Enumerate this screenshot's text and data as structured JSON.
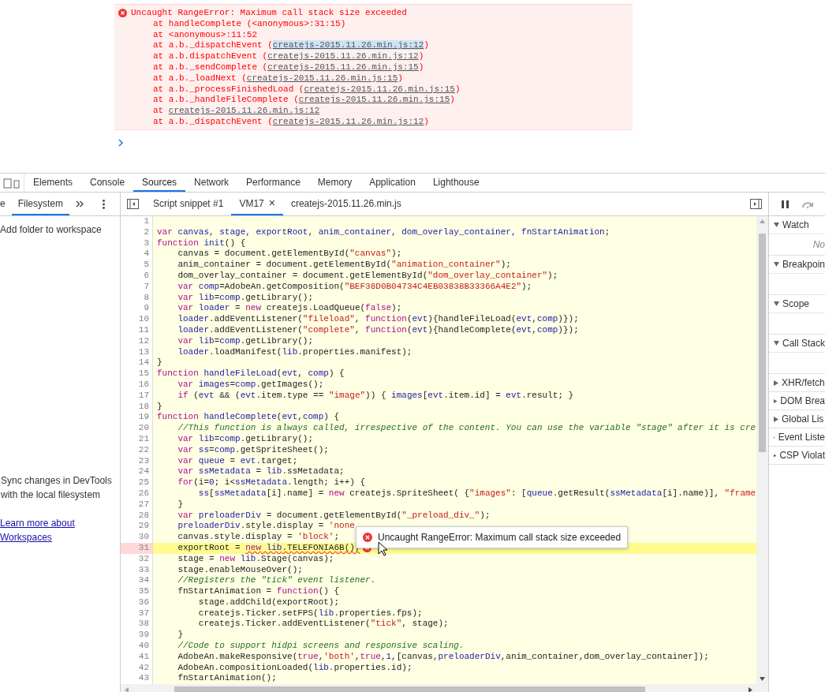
{
  "console": {
    "error": {
      "message": "Uncaught RangeError: Maximum call stack size exceeded",
      "frames": [
        {
          "text": "at handleComplete (<anonymous>:31:15)",
          "selected": false
        },
        {
          "text": "at <anonymous>:11:52",
          "selected": false
        },
        {
          "text": "at a.b._dispatchEvent (",
          "link": "createjs-2015.11.26.min.js:12",
          "after": ")",
          "selected": true
        },
        {
          "text": "at a.b.dispatchEvent (",
          "link": "createjs-2015.11.26.min.js:12",
          "after": ")",
          "selected": false
        },
        {
          "text": "at a.b._sendComplete (",
          "link": "createjs-2015.11.26.min.js:15",
          "after": ")",
          "selected": false
        },
        {
          "text": "at a.b._loadNext (",
          "link": "createjs-2015.11.26.min.js:15",
          "after": ")",
          "selected": false
        },
        {
          "text": "at a.b._processFinishedLoad (",
          "link": "createjs-2015.11.26.min.js:15",
          "after": ")",
          "selected": false
        },
        {
          "text": "at a.b._handleFileComplete (",
          "link": "createjs-2015.11.26.min.js:15",
          "after": ")",
          "selected": false
        },
        {
          "text": "at ",
          "link": "createjs-2015.11.26.min.js:12",
          "selected": false
        },
        {
          "text": "at a.b._dispatchEvent (",
          "link": "createjs-2015.11.26.min.js:12",
          "after": ")",
          "selected": false
        }
      ]
    }
  },
  "devtools": {
    "main_tabs": [
      {
        "label": "Elements",
        "selected": false
      },
      {
        "label": "Console",
        "selected": false
      },
      {
        "label": "Sources",
        "selected": true
      },
      {
        "label": "Network",
        "selected": false
      },
      {
        "label": "Performance",
        "selected": false
      },
      {
        "label": "Memory",
        "selected": false
      },
      {
        "label": "Application",
        "selected": false
      },
      {
        "label": "Lighthouse",
        "selected": false
      }
    ],
    "navigator": {
      "tabs": [
        {
          "label": "e",
          "selected": false
        },
        {
          "label": "Filesystem",
          "selected": true
        }
      ],
      "action": "Add folder to workspace",
      "info": "Sync changes in DevTools with the local filesystem",
      "link": "Learn more about Workspaces"
    },
    "editor": {
      "tabs": [
        {
          "label": "Script snippet #1",
          "selected": false
        },
        {
          "label": "VM17",
          "selected": true,
          "close": "×"
        },
        {
          "label": "createjs-2015.11.26.min.js",
          "selected": false
        }
      ],
      "lines": [
        {
          "number": "1",
          "error": false
        },
        {
          "number": "2",
          "error": false,
          "segments": [
            {
              "kind": "kw",
              "text": "var"
            },
            {
              "kind": "def",
              "text": " canvas, stage, exportRoot, anim_container, dom_overlay_container, fnStartAnimation"
            },
            {
              "kind": "txt",
              "text": ";"
            }
          ]
        },
        {
          "number": "3",
          "error": false,
          "segments": [
            {
              "kind": "kw",
              "text": "function"
            },
            {
              "kind": "def",
              "text": " init"
            },
            {
              "kind": "txt",
              "text": "() {"
            }
          ]
        },
        {
          "number": "4",
          "error": false,
          "segments": [
            {
              "kind": "txt",
              "text": "    canvas = document.getElementById("
            },
            {
              "kind": "str",
              "text": "\"canvas\""
            },
            {
              "kind": "txt",
              "text": ");"
            }
          ]
        },
        {
          "number": "5",
          "error": false,
          "segments": [
            {
              "kind": "txt",
              "text": "    anim_container = document.getElementById("
            },
            {
              "kind": "str",
              "text": "\"animation_container\""
            },
            {
              "kind": "txt",
              "text": ");"
            }
          ]
        },
        {
          "number": "6",
          "error": false,
          "segments": [
            {
              "kind": "txt",
              "text": "    dom_overlay_container = document.getElementById("
            },
            {
              "kind": "str",
              "text": "\"dom_overlay_container\""
            },
            {
              "kind": "txt",
              "text": ");"
            }
          ]
        },
        {
          "number": "7",
          "error": false,
          "segments": [
            {
              "kind": "kw",
              "text": "    var"
            },
            {
              "kind": "def",
              "text": " comp"
            },
            {
              "kind": "txt",
              "text": "=AdobeAn.getComposition("
            },
            {
              "kind": "str",
              "text": "\"BEF38D0B04734C4EB03838B33366A4E2\""
            },
            {
              "kind": "txt",
              "text": ");"
            }
          ]
        },
        {
          "number": "8",
          "error": false,
          "segments": [
            {
              "kind": "kw",
              "text": "    var"
            },
            {
              "kind": "def",
              "text": " lib"
            },
            {
              "kind": "txt",
              "text": "="
            },
            {
              "kind": "def",
              "text": "comp"
            },
            {
              "kind": "txt",
              "text": ".getLibrary();"
            }
          ]
        },
        {
          "number": "9",
          "error": false,
          "segments": [
            {
              "kind": "kw",
              "text": "    var"
            },
            {
              "kind": "def",
              "text": " loader"
            },
            {
              "kind": "txt",
              "text": " = "
            },
            {
              "kind": "kw",
              "text": "new"
            },
            {
              "kind": "txt",
              "text": " createjs.LoadQueue("
            },
            {
              "kind": "kw",
              "text": "false"
            },
            {
              "kind": "txt",
              "text": ");"
            }
          ]
        },
        {
          "number": "10",
          "error": false,
          "segments": [
            {
              "kind": "def",
              "text": "    loader"
            },
            {
              "kind": "txt",
              "text": ".addEventListener("
            },
            {
              "kind": "str",
              "text": "\"fileload\""
            },
            {
              "kind": "txt",
              "text": ", "
            },
            {
              "kind": "kw",
              "text": "function"
            },
            {
              "kind": "txt",
              "text": "("
            },
            {
              "kind": "def",
              "text": "evt"
            },
            {
              "kind": "txt",
              "text": "){handleFileLoad("
            },
            {
              "kind": "def",
              "text": "evt"
            },
            {
              "kind": "txt",
              "text": ","
            },
            {
              "kind": "def",
              "text": "comp"
            },
            {
              "kind": "txt",
              "text": ")});"
            }
          ]
        },
        {
          "number": "11",
          "error": false,
          "segments": [
            {
              "kind": "def",
              "text": "    loader"
            },
            {
              "kind": "txt",
              "text": ".addEventListener("
            },
            {
              "kind": "str",
              "text": "\"complete\""
            },
            {
              "kind": "txt",
              "text": ", "
            },
            {
              "kind": "kw",
              "text": "function"
            },
            {
              "kind": "txt",
              "text": "("
            },
            {
              "kind": "def",
              "text": "evt"
            },
            {
              "kind": "txt",
              "text": "){handleComplete("
            },
            {
              "kind": "def",
              "text": "evt"
            },
            {
              "kind": "txt",
              "text": ","
            },
            {
              "kind": "def",
              "text": "comp"
            },
            {
              "kind": "txt",
              "text": ")});"
            }
          ]
        },
        {
          "number": "12",
          "error": false,
          "segments": [
            {
              "kind": "kw",
              "text": "    var"
            },
            {
              "kind": "def",
              "text": " lib"
            },
            {
              "kind": "txt",
              "text": "="
            },
            {
              "kind": "def",
              "text": "comp"
            },
            {
              "kind": "txt",
              "text": ".getLibrary();"
            }
          ]
        },
        {
          "number": "13",
          "error": false,
          "segments": [
            {
              "kind": "def",
              "text": "    loader"
            },
            {
              "kind": "txt",
              "text": ".loadManifest("
            },
            {
              "kind": "def",
              "text": "lib"
            },
            {
              "kind": "txt",
              "text": ".properties.manifest);"
            }
          ]
        },
        {
          "number": "14",
          "error": false,
          "segments": [
            {
              "kind": "txt",
              "text": "}"
            }
          ]
        },
        {
          "number": "15",
          "error": false,
          "segments": [
            {
              "kind": "kw",
              "text": "function"
            },
            {
              "kind": "def",
              "text": " handleFileLoad"
            },
            {
              "kind": "txt",
              "text": "("
            },
            {
              "kind": "def",
              "text": "evt"
            },
            {
              "kind": "txt",
              "text": ", "
            },
            {
              "kind": "def",
              "text": "comp"
            },
            {
              "kind": "txt",
              "text": ") {"
            }
          ]
        },
        {
          "number": "16",
          "error": false,
          "segments": [
            {
              "kind": "kw",
              "text": "    var"
            },
            {
              "kind": "def",
              "text": " images"
            },
            {
              "kind": "txt",
              "text": "="
            },
            {
              "kind": "def",
              "text": "comp"
            },
            {
              "kind": "txt",
              "text": ".getImages();"
            }
          ]
        },
        {
          "number": "17",
          "error": false,
          "segments": [
            {
              "kind": "kw",
              "text": "    if"
            },
            {
              "kind": "txt",
              "text": " ("
            },
            {
              "kind": "def",
              "text": "evt"
            },
            {
              "kind": "txt",
              "text": " && ("
            },
            {
              "kind": "def",
              "text": "evt"
            },
            {
              "kind": "txt",
              "text": ".item.type == "
            },
            {
              "kind": "str",
              "text": "\"image\""
            },
            {
              "kind": "txt",
              "text": ")) { "
            },
            {
              "kind": "def",
              "text": "images"
            },
            {
              "kind": "txt",
              "text": "["
            },
            {
              "kind": "def",
              "text": "evt"
            },
            {
              "kind": "txt",
              "text": ".item.id] = "
            },
            {
              "kind": "def",
              "text": "evt"
            },
            {
              "kind": "txt",
              "text": ".result; }"
            }
          ]
        },
        {
          "number": "18",
          "error": false,
          "segments": [
            {
              "kind": "txt",
              "text": "}"
            }
          ]
        },
        {
          "number": "19",
          "error": false,
          "segments": [
            {
              "kind": "kw",
              "text": "function"
            },
            {
              "kind": "def",
              "text": " handleComplete"
            },
            {
              "kind": "txt",
              "text": "("
            },
            {
              "kind": "def",
              "text": "evt"
            },
            {
              "kind": "txt",
              "text": ","
            },
            {
              "kind": "def",
              "text": "comp"
            },
            {
              "kind": "txt",
              "text": ") {"
            }
          ]
        },
        {
          "number": "20",
          "error": false,
          "segments": [
            {
              "kind": "com",
              "text": "    //This function is always called, irrespective of the content. You can use the variable \"stage\" after it is cre"
            }
          ]
        },
        {
          "number": "21",
          "error": false,
          "segments": [
            {
              "kind": "kw",
              "text": "    var"
            },
            {
              "kind": "def",
              "text": " lib"
            },
            {
              "kind": "txt",
              "text": "="
            },
            {
              "kind": "def",
              "text": "comp"
            },
            {
              "kind": "txt",
              "text": ".getLibrary();"
            }
          ]
        },
        {
          "number": "22",
          "error": false,
          "segments": [
            {
              "kind": "kw",
              "text": "    var"
            },
            {
              "kind": "def",
              "text": " ss"
            },
            {
              "kind": "txt",
              "text": "="
            },
            {
              "kind": "def",
              "text": "comp"
            },
            {
              "kind": "txt",
              "text": ".getSpriteSheet();"
            }
          ]
        },
        {
          "number": "23",
          "error": false,
          "segments": [
            {
              "kind": "kw",
              "text": "    var"
            },
            {
              "kind": "def",
              "text": " queue"
            },
            {
              "kind": "txt",
              "text": " = "
            },
            {
              "kind": "def",
              "text": "evt"
            },
            {
              "kind": "txt",
              "text": ".target;"
            }
          ]
        },
        {
          "number": "24",
          "error": false,
          "segments": [
            {
              "kind": "kw",
              "text": "    var"
            },
            {
              "kind": "def",
              "text": " ssMetadata"
            },
            {
              "kind": "txt",
              "text": " = "
            },
            {
              "kind": "def",
              "text": "lib"
            },
            {
              "kind": "txt",
              "text": ".ssMetadata;"
            }
          ]
        },
        {
          "number": "25",
          "error": false,
          "segments": [
            {
              "kind": "kw",
              "text": "    for"
            },
            {
              "kind": "txt",
              "text": "(i="
            },
            {
              "kind": "num",
              "text": "0"
            },
            {
              "kind": "txt",
              "text": "; i<"
            },
            {
              "kind": "def",
              "text": "ssMetadata"
            },
            {
              "kind": "txt",
              "text": ".length; i++) {"
            }
          ]
        },
        {
          "number": "26",
          "error": false,
          "segments": [
            {
              "kind": "def",
              "text": "        ss"
            },
            {
              "kind": "txt",
              "text": "["
            },
            {
              "kind": "def",
              "text": "ssMetadata"
            },
            {
              "kind": "txt",
              "text": "[i].name] = "
            },
            {
              "kind": "kw",
              "text": "new"
            },
            {
              "kind": "txt",
              "text": " createjs.SpriteSheet( {"
            },
            {
              "kind": "str",
              "text": "\"images\""
            },
            {
              "kind": "txt",
              "text": ": ["
            },
            {
              "kind": "def",
              "text": "queue"
            },
            {
              "kind": "txt",
              "text": ".getResult("
            },
            {
              "kind": "def",
              "text": "ssMetadata"
            },
            {
              "kind": "txt",
              "text": "[i].name)], "
            },
            {
              "kind": "str",
              "text": "\"frame"
            }
          ]
        },
        {
          "number": "27",
          "error": false,
          "segments": [
            {
              "kind": "txt",
              "text": "    }"
            }
          ]
        },
        {
          "number": "28",
          "error": false,
          "segments": [
            {
              "kind": "kw",
              "text": "    var"
            },
            {
              "kind": "def",
              "text": " preloaderDiv"
            },
            {
              "kind": "txt",
              "text": " = document.getElementById("
            },
            {
              "kind": "str",
              "text": "\"_preload_div_\""
            },
            {
              "kind": "txt",
              "text": ");"
            }
          ]
        },
        {
          "number": "29",
          "error": false,
          "segments": [
            {
              "kind": "def",
              "text": "    preloaderDiv"
            },
            {
              "kind": "txt",
              "text": ".style.display = "
            },
            {
              "kind": "str",
              "text": "'none"
            }
          ]
        },
        {
          "number": "30",
          "error": false,
          "segments": [
            {
              "kind": "txt",
              "text": "    canvas.style.display = "
            },
            {
              "kind": "str",
              "text": "'block'"
            },
            {
              "kind": "txt",
              "text": ";"
            }
          ]
        },
        {
          "number": "31",
          "error": true,
          "segments": [
            {
              "kind": "txt",
              "text": "    exportRoot = "
            },
            {
              "kind": "kw-squiggle",
              "text": "new"
            },
            {
              "kind": "def-squiggle",
              "text": " lib"
            },
            {
              "kind": "txt-squiggle",
              "text": ".TELEFONIA6B();"
            }
          ]
        },
        {
          "number": "32",
          "error": false,
          "segments": [
            {
              "kind": "txt",
              "text": "    stage = "
            },
            {
              "kind": "kw",
              "text": "new"
            },
            {
              "kind": "def",
              "text": " lib"
            },
            {
              "kind": "txt",
              "text": ".Stage(canvas);"
            }
          ]
        },
        {
          "number": "33",
          "error": false,
          "segments": [
            {
              "kind": "txt",
              "text": "    stage.enableMouseOver();"
            }
          ]
        },
        {
          "number": "34",
          "error": false,
          "segments": [
            {
              "kind": "com",
              "text": "    //Registers the \"tick\" event listener."
            }
          ]
        },
        {
          "number": "35",
          "error": false,
          "segments": [
            {
              "kind": "txt",
              "text": "    fnStartAnimation = "
            },
            {
              "kind": "kw",
              "text": "function"
            },
            {
              "kind": "txt",
              "text": "() {"
            }
          ]
        },
        {
          "number": "36",
          "error": false,
          "segments": [
            {
              "kind": "txt",
              "text": "        stage.addChild(exportRoot);"
            }
          ]
        },
        {
          "number": "37",
          "error": false,
          "segments": [
            {
              "kind": "txt",
              "text": "        createjs.Ticker.setFPS("
            },
            {
              "kind": "def",
              "text": "lib"
            },
            {
              "kind": "txt",
              "text": ".properties.fps);"
            }
          ]
        },
        {
          "number": "38",
          "error": false,
          "segments": [
            {
              "kind": "txt",
              "text": "        createjs.Ticker.addEventListener("
            },
            {
              "kind": "str",
              "text": "\"tick\""
            },
            {
              "kind": "txt",
              "text": ", stage);"
            }
          ]
        },
        {
          "number": "39",
          "error": false,
          "segments": [
            {
              "kind": "txt",
              "text": "    }"
            }
          ]
        },
        {
          "number": "40",
          "error": false,
          "segments": [
            {
              "kind": "com",
              "text": "    //Code to support hidpi screens and responsive scaling."
            }
          ]
        },
        {
          "number": "41",
          "error": false,
          "segments": [
            {
              "kind": "txt",
              "text": "    AdobeAn.makeResponsive("
            },
            {
              "kind": "kw",
              "text": "true"
            },
            {
              "kind": "txt",
              "text": ","
            },
            {
              "kind": "str",
              "text": "'both'"
            },
            {
              "kind": "txt",
              "text": ","
            },
            {
              "kind": "kw",
              "text": "true"
            },
            {
              "kind": "txt",
              "text": ","
            },
            {
              "kind": "num",
              "text": "1"
            },
            {
              "kind": "txt",
              "text": ",[canvas,"
            },
            {
              "kind": "def",
              "text": "preloaderDiv"
            },
            {
              "kind": "txt",
              "text": ",anim_container,dom_overlay_container]);"
            }
          ]
        },
        {
          "number": "42",
          "error": false,
          "segments": [
            {
              "kind": "txt",
              "text": "    AdobeAn.compositionLoaded("
            },
            {
              "kind": "def",
              "text": "lib"
            },
            {
              "kind": "txt",
              "text": ".properties.id);"
            }
          ]
        },
        {
          "number": "43",
          "error": false,
          "segments": [
            {
              "kind": "txt",
              "text": "    fnStartAnimation();"
            }
          ]
        }
      ],
      "tooltip": "Uncaught RangeError: Maximum call stack size exceeded"
    },
    "debugger": {
      "sections": [
        {
          "title": "Watch",
          "expanded": true,
          "body": "No"
        },
        {
          "title": "Breakpoin",
          "expanded": true
        },
        {
          "title": "Scope",
          "expanded": true
        },
        {
          "title": "Call Stack",
          "expanded": true
        },
        {
          "title": "XHR/fetch",
          "expanded": false
        },
        {
          "title": "DOM Brea",
          "expanded": false
        },
        {
          "title": "Global Lis",
          "expanded": false
        },
        {
          "title": "Event Liste",
          "expanded": false
        },
        {
          "title": "CSP Violat",
          "expanded": false
        }
      ]
    }
  }
}
